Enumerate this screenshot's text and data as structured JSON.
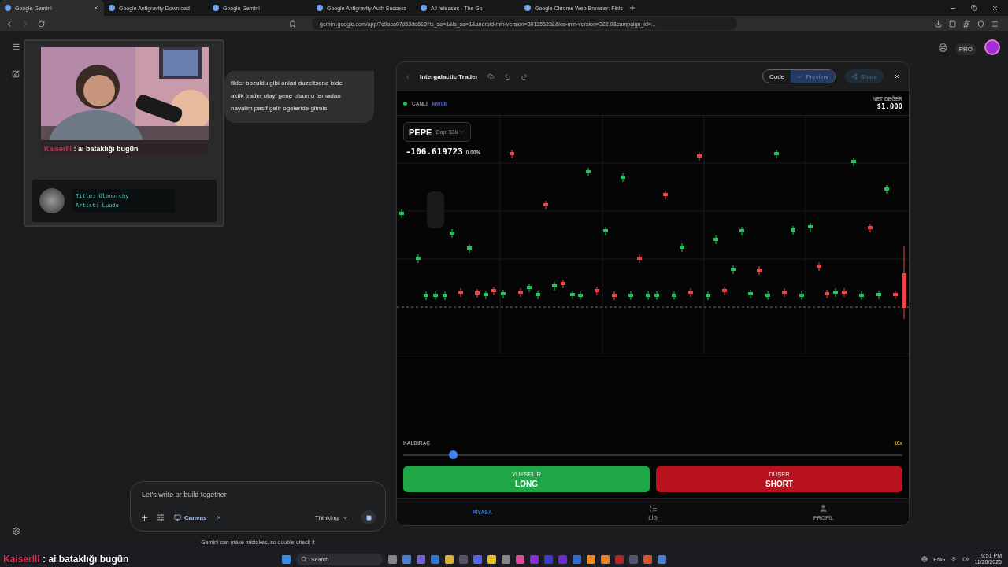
{
  "browser": {
    "tabs": [
      {
        "title": "Google Gemini",
        "selected": true
      },
      {
        "title": "Google Antigravity Download",
        "selected": false
      },
      {
        "title": "Google Gemini",
        "selected": false
      },
      {
        "title": "Google Antigravity Auth Success",
        "selected": false
      },
      {
        "title": "All releases - The Go",
        "selected": false
      },
      {
        "title": "Google Chrome Web Browser: Finis",
        "selected": false
      }
    ],
    "url": "gemini.google.com/app/7c9aca07d53dd618?is_sa=1&is_sa=1&android-min-version=301356232&ios-min-version=322.0&campaign_id=..."
  },
  "header": {
    "badge": "PRO"
  },
  "stream_overlay": {
    "chat_user": "Kaiserlll",
    "chat_text": ": ai bataklığı bugün",
    "track_title": "Title: Glenorchy",
    "track_artist": "Artist: Luude"
  },
  "chat": {
    "user_message": [
      "fikler bozuldu gibi onlari duzeltsene bide",
      "aktik trader olayi gene olsun o temadan",
      "nayalim pasif gelir ogeleride gitmis"
    ],
    "input": {
      "placeholder": "Let's write or build together"
    },
    "tool_chip": "Canvas",
    "model": "Thinking",
    "disclaimer": "Gemini can make mistakes, so double-check it"
  },
  "canvas": {
    "title": "Intergalactic Trader",
    "view_toggle": [
      {
        "label": "Code",
        "selected": false
      },
      {
        "label": "Preview",
        "selected": true
      }
    ],
    "share": "Share",
    "app": {
      "status": "CANLI",
      "user": "kavuk",
      "net_label": "NET DEĞER",
      "net_value": "$1,000",
      "symbol": "PEPE",
      "cap": "Cap: $1k",
      "price": "-106.619723",
      "change": "0.00%",
      "leverage_label": "KALDIRAÇ",
      "leverage_value": "10x",
      "leverage": {
        "level": 0.1
      },
      "actions": [
        {
          "kind": "long",
          "caption": "YÜKSELİR",
          "label": "LONG"
        },
        {
          "kind": "short",
          "caption": "DÜŞER",
          "label": "SHORT"
        }
      ],
      "nav": [
        {
          "label": "PİYASA",
          "selected": true
        },
        {
          "label": "LİG",
          "selected": false
        },
        {
          "label": "PROFİL",
          "selected": false
        }
      ]
    }
  },
  "bottom_caption": {
    "user": "Kaiserlll",
    "text": ": ai bataklığı bugün"
  },
  "taskbar": {
    "search": "Search",
    "language": "ENG",
    "time": "9:51 PM",
    "date": "11/20/2025"
  }
}
